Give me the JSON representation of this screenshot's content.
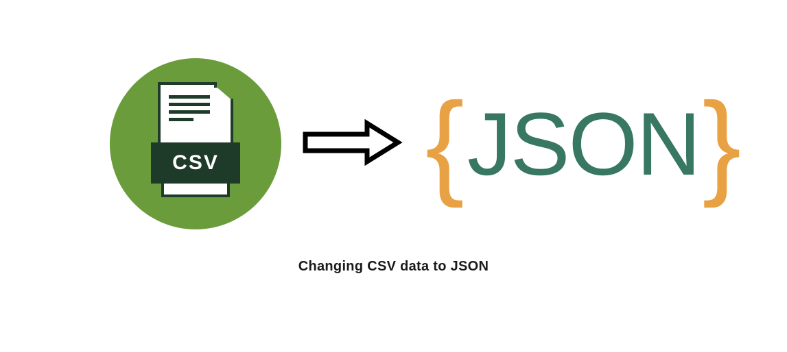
{
  "csv": {
    "label": "CSV"
  },
  "json": {
    "open_brace": "{",
    "text": "JSON",
    "close_brace": "}"
  },
  "caption": "Changing CSV data to JSON"
}
